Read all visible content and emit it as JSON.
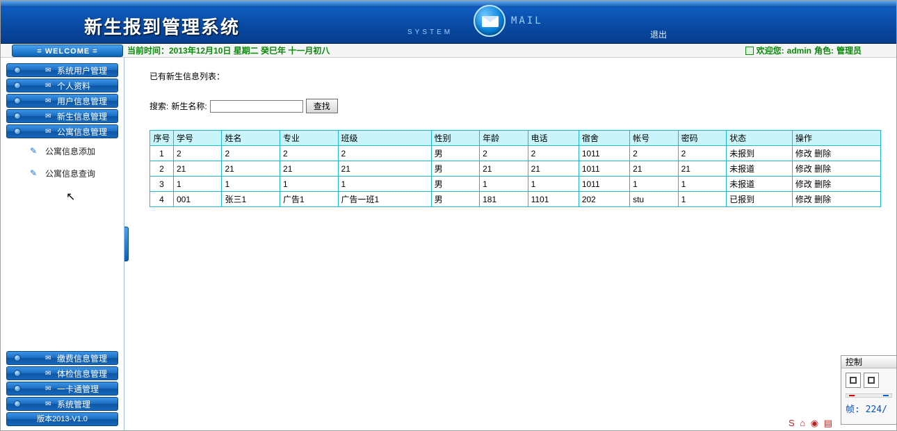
{
  "header": {
    "app_title": "新生报到管理系统",
    "system_label": "SYSTEM",
    "mail_label": "MAIL",
    "logout": "退出"
  },
  "infostrip": {
    "welcome": "= WELCOME =",
    "time_text": "当前时间：2013年12月10日 星期二 癸巳年 十一月初八",
    "greet_prefix": "欢迎您:",
    "user": "admin",
    "role_prefix": "角色:",
    "role": "管理员"
  },
  "sidebar": {
    "top_items": [
      {
        "label": "系统用户管理"
      },
      {
        "label": "个人资料"
      },
      {
        "label": "用户信息管理"
      },
      {
        "label": "新生信息管理"
      },
      {
        "label": "公寓信息管理"
      }
    ],
    "sub_items": [
      {
        "label": "公寓信息添加"
      },
      {
        "label": "公寓信息查询"
      }
    ],
    "bottom_items": [
      {
        "label": "缴费信息管理"
      },
      {
        "label": "体检信息管理"
      },
      {
        "label": "一卡通管理"
      },
      {
        "label": "系统管理"
      }
    ],
    "version": "版本2013-V1.0"
  },
  "main": {
    "list_title": "已有新生信息列表：",
    "search_label": "搜索:",
    "search_field_label": "新生名称:",
    "search_value": "",
    "search_btn": "查找",
    "table": {
      "headers": [
        "序号",
        "学号",
        "姓名",
        "专业",
        "班级",
        "性别",
        "年龄",
        "电话",
        "宿舍",
        "帐号",
        "密码",
        "状态",
        "操作"
      ],
      "rows": [
        {
          "idx": "1",
          "cells": [
            "2",
            "2",
            "2",
            "2",
            "男",
            "2",
            "2",
            "1011",
            "2",
            "2",
            "未报到"
          ]
        },
        {
          "idx": "2",
          "cells": [
            "21",
            "21",
            "21",
            "21",
            "男",
            "21",
            "21",
            "1011",
            "21",
            "21",
            "未报道"
          ]
        },
        {
          "idx": "3",
          "cells": [
            "1",
            "1",
            "1",
            "1",
            "男",
            "1",
            "1",
            "1011",
            "1",
            "1",
            "未报道"
          ]
        },
        {
          "idx": "4",
          "cells": [
            "001",
            "张三1",
            "广告1",
            "广告一班1",
            "男",
            "181",
            "1101",
            "202",
            "stu",
            "1",
            "已报到"
          ]
        }
      ],
      "op_edit": "修改",
      "op_delete": "删除"
    }
  },
  "control_panel": {
    "title": "控制",
    "fps_label": "帧:",
    "fps_value": "224/"
  }
}
